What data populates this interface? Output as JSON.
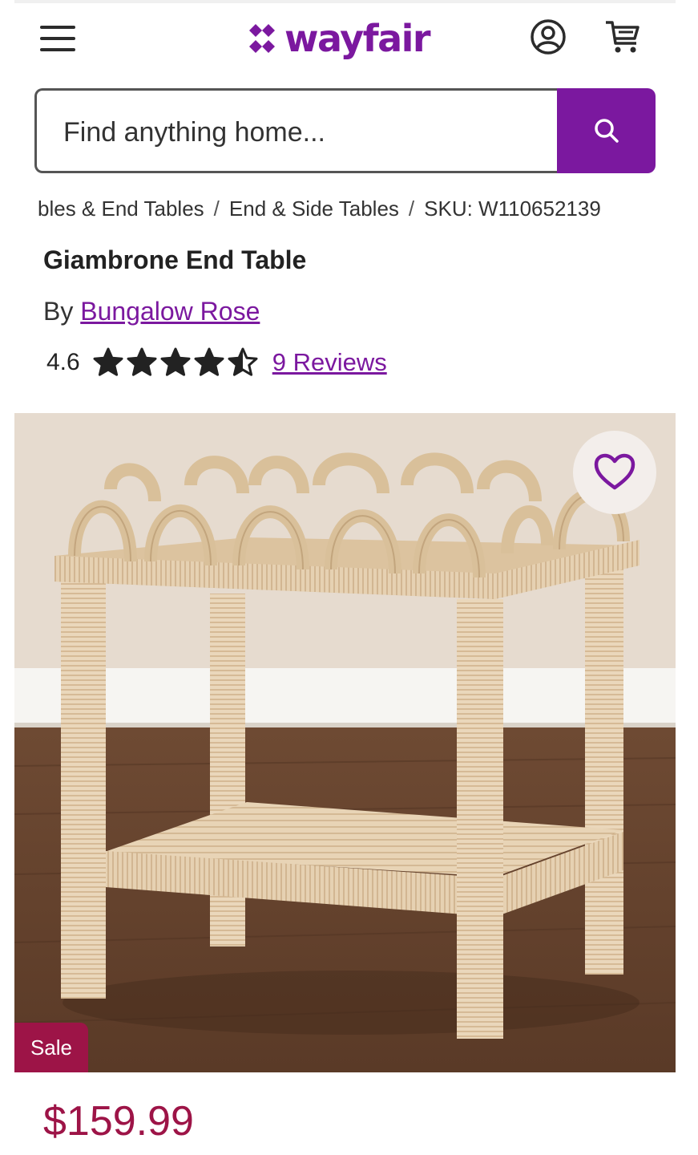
{
  "header": {
    "logo_text": "wayfair",
    "brand_color": "#7b189f",
    "icons": [
      "menu-icon",
      "wayfair-logo-icon",
      "account-icon",
      "cart-icon"
    ]
  },
  "search": {
    "placeholder": "Find anything home...",
    "button_icon": "search-icon"
  },
  "breadcrumb": {
    "items": [
      "bles & End Tables",
      "End & Side Tables",
      "SKU: W110652139"
    ],
    "separator": "/"
  },
  "product": {
    "title": "Giambrone End Table",
    "by_prefix": "By",
    "brand": "Bungalow Rose",
    "rating": "4.6",
    "rating_value": 4.6,
    "stars_max": 5,
    "reviews_label": "9 Reviews",
    "sale_badge": "Sale",
    "price": "$159.99",
    "price_color": "#9d1447",
    "favorite_icon": "heart-icon"
  }
}
